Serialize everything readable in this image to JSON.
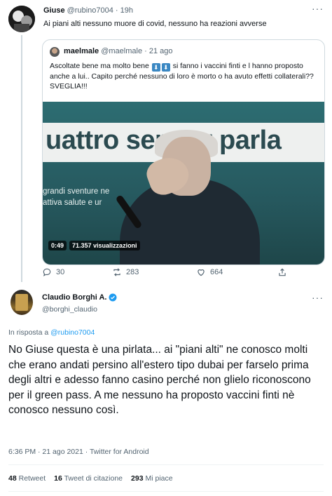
{
  "parent_tweet": {
    "name": "Giuse",
    "handle": "@rubino7004",
    "time": "19h",
    "text": "Ai piani alti nessuno muore di covid, nessuno ha reazioni avverse",
    "quote": {
      "name": "maelmale",
      "handle": "@maelmale",
      "time": "21 ago",
      "text_part1": "Ascoltate bene ma molto bene",
      "text_part2": "si fanno i vaccini finti e l hanno proposto anche a lui.. Capito perché nessuno di loro è morto o ha avuto effetti collaterali?? SVEGLIA!!!",
      "video": {
        "banner_text": "uattro ser  per parla",
        "slide_line1": "grandi sventure ne",
        "slide_line2": "attiva salute e ur",
        "duration": "0:49",
        "views": "71.357 visualizzazioni"
      }
    },
    "actions": {
      "replies": "30",
      "retweets": "283",
      "likes": "664"
    }
  },
  "main_tweet": {
    "name": "Claudio Borghi A.",
    "handle": "@borghi_claudio",
    "reply_prefix": "In risposta a",
    "reply_handle": "@rubino7004",
    "text": "No Giuse questa è una pirlata... ai \"piani alti\" ne conosco molti che erano andati persino all'estero tipo dubai per farselo prima degli altri e adesso fanno casino perché non glielo riconoscono per il green pass. A me nessuno ha proposto vaccini finti nè conosco nessuno così.",
    "meta": "6:36 PM · 21 ago 2021 · Twitter for Android",
    "stats": {
      "retweets_count": "48",
      "retweets_label": "Retweet",
      "quotes_count": "16",
      "quotes_label": "Tweet di citazione",
      "likes_count": "293",
      "likes_label": "Mi piace"
    }
  },
  "icons": {
    "reply": "reply-icon",
    "retweet": "retweet-icon",
    "like": "heart-icon",
    "share": "share-icon",
    "more": "more-icon",
    "verified": "verified-badge-icon"
  },
  "colors": {
    "accent": "#1d9bf0",
    "text": "#0f1419",
    "muted": "#536471",
    "border": "#cfd9de"
  }
}
